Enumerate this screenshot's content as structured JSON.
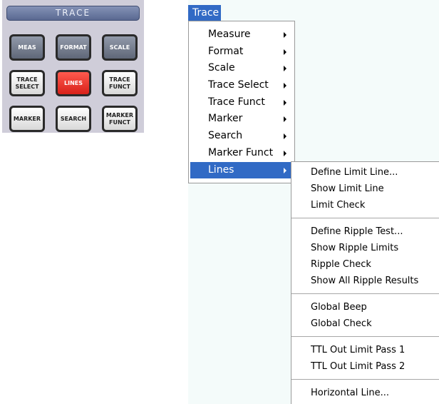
{
  "trace_panel": {
    "title": "TRACE",
    "buttons": [
      {
        "label": "MEAS",
        "style": "dark"
      },
      {
        "label": "FORMAT",
        "style": "dark"
      },
      {
        "label": "SCALE",
        "style": "dark"
      },
      {
        "label": "TRACE\nSELECT",
        "style": "light"
      },
      {
        "label": "LINES",
        "style": "red"
      },
      {
        "label": "TRACE\nFUNCT",
        "style": "light"
      },
      {
        "label": "MARKER",
        "style": "light"
      },
      {
        "label": "SEARCH",
        "style": "light"
      },
      {
        "label": "MARKER\nFUNCT",
        "style": "light"
      }
    ]
  },
  "menubar": {
    "trace_label": "Trace"
  },
  "trace_menu": {
    "items": [
      "Measure",
      "Format",
      "Scale",
      "Trace Select",
      "Trace Funct",
      "Marker",
      "Search",
      "Marker Funct",
      "Lines"
    ],
    "active_index": 8
  },
  "lines_submenu": {
    "groups": [
      [
        "Define Limit Line...",
        "Show Limit Line",
        "Limit Check"
      ],
      [
        "Define Ripple Test...",
        "Show Ripple Limits",
        "Ripple Check",
        "Show All Ripple Results"
      ],
      [
        "Global Beep",
        "Global Check"
      ],
      [
        "TTL Out Limit Pass 1",
        "TTL Out Limit Pass 2"
      ],
      [
        "Horizontal Line..."
      ]
    ]
  },
  "colors": {
    "menu_highlight": "#316ac5",
    "lines_key_active": "#e32b22",
    "app_background": "#f4fbfa"
  }
}
